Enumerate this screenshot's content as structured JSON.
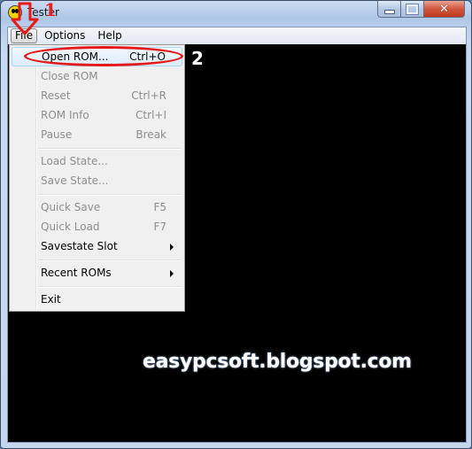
{
  "window": {
    "title": "Tester",
    "icon": "smiley-app-icon",
    "controls": {
      "minimize": "minimize",
      "maximize": "maximize",
      "close": "✕"
    }
  },
  "menubar": {
    "items": [
      {
        "label": "File",
        "active": true
      },
      {
        "label": "Options",
        "active": false
      },
      {
        "label": "Help",
        "active": false
      }
    ]
  },
  "file_menu": {
    "items": [
      {
        "label": "Open ROM...",
        "shortcut": "Ctrl+O",
        "enabled": true,
        "highlighted": true
      },
      {
        "label": "Close ROM",
        "shortcut": "",
        "enabled": false
      },
      {
        "label": "Reset",
        "shortcut": "Ctrl+R",
        "enabled": false
      },
      {
        "label": "ROM Info",
        "shortcut": "Ctrl+I",
        "enabled": false
      },
      {
        "label": "Pause",
        "shortcut": "Break",
        "enabled": false
      },
      {
        "label": "Load State...",
        "shortcut": "",
        "enabled": false
      },
      {
        "label": "Save State...",
        "shortcut": "",
        "enabled": false
      },
      {
        "label": "Quick Save",
        "shortcut": "F5",
        "enabled": false
      },
      {
        "label": "Quick Load",
        "shortcut": "F7",
        "enabled": false
      },
      {
        "label": "Savestate Slot",
        "shortcut": "",
        "enabled": true,
        "submenu": true
      },
      {
        "label": "Recent ROMs",
        "shortcut": "",
        "enabled": true,
        "submenu": true
      },
      {
        "label": "Exit",
        "shortcut": "",
        "enabled": true
      }
    ]
  },
  "annotations": {
    "step1": "1",
    "step2": "2",
    "arrow_color": "#e61919",
    "watermark": "easypcsoft.blogspot.com"
  }
}
